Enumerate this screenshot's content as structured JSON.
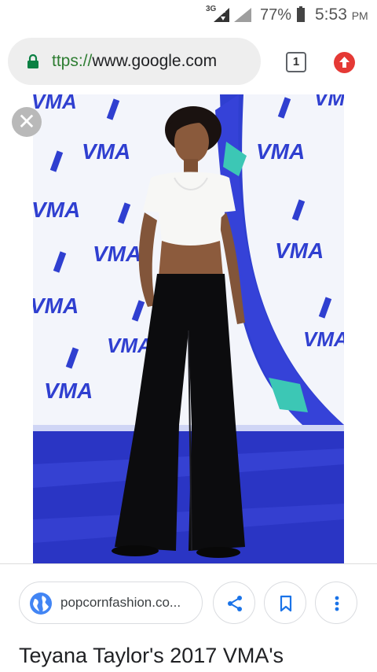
{
  "status_bar": {
    "network": "3G",
    "battery_percent": "77%",
    "time": "5:53",
    "ampm": "PM"
  },
  "toolbar": {
    "url_scheme": "ttps://",
    "url_host": "www.google.com",
    "tab_count": "1"
  },
  "image_viewer": {
    "source_label": "popcornfashion.co...",
    "title": "Teyana Taylor's 2017 VMA's",
    "backdrop_logo_text": "VMA",
    "accent_color": "#2f3fd0",
    "teal_color": "#3cc7b5"
  },
  "icons": {
    "lock": "lock-icon",
    "update": "arrow-up-icon",
    "close": "close-icon",
    "globe": "globe-icon",
    "share": "share-icon",
    "bookmark": "bookmark-icon",
    "more": "more-vert-icon"
  }
}
